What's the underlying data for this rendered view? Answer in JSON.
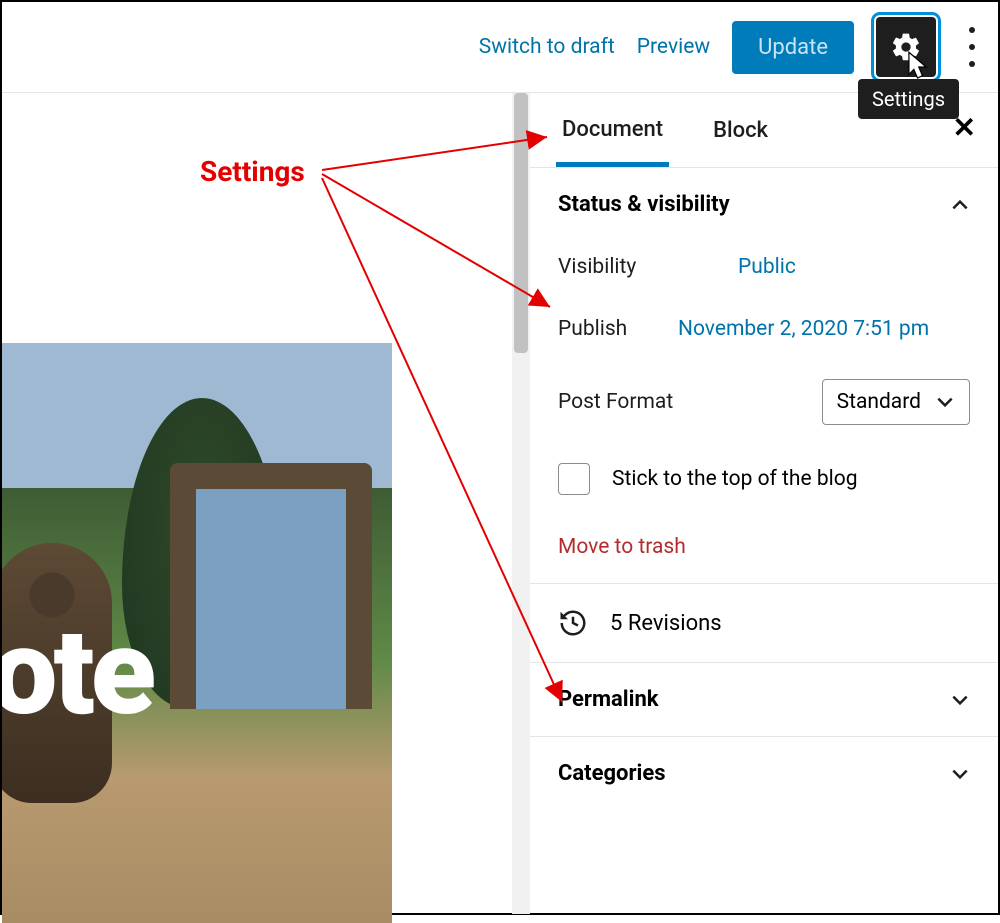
{
  "toolbar": {
    "switch_to_draft": "Switch to draft",
    "preview": "Preview",
    "update": "Update",
    "settings_tooltip": "Settings"
  },
  "annotation": {
    "label": "Settings"
  },
  "canvas": {
    "overlay_text": "ote"
  },
  "sidebar": {
    "tabs": {
      "document": "Document",
      "block": "Block"
    },
    "status": {
      "title": "Status & visibility",
      "visibility_label": "Visibility",
      "visibility_value": "Public",
      "publish_label": "Publish",
      "publish_value": "November 2, 2020 7:51 pm",
      "format_label": "Post Format",
      "format_value": "Standard",
      "stick_label": "Stick to the top of the blog",
      "trash": "Move to trash"
    },
    "revisions": "5 Revisions",
    "permalink": "Permalink",
    "categories": "Categories"
  }
}
